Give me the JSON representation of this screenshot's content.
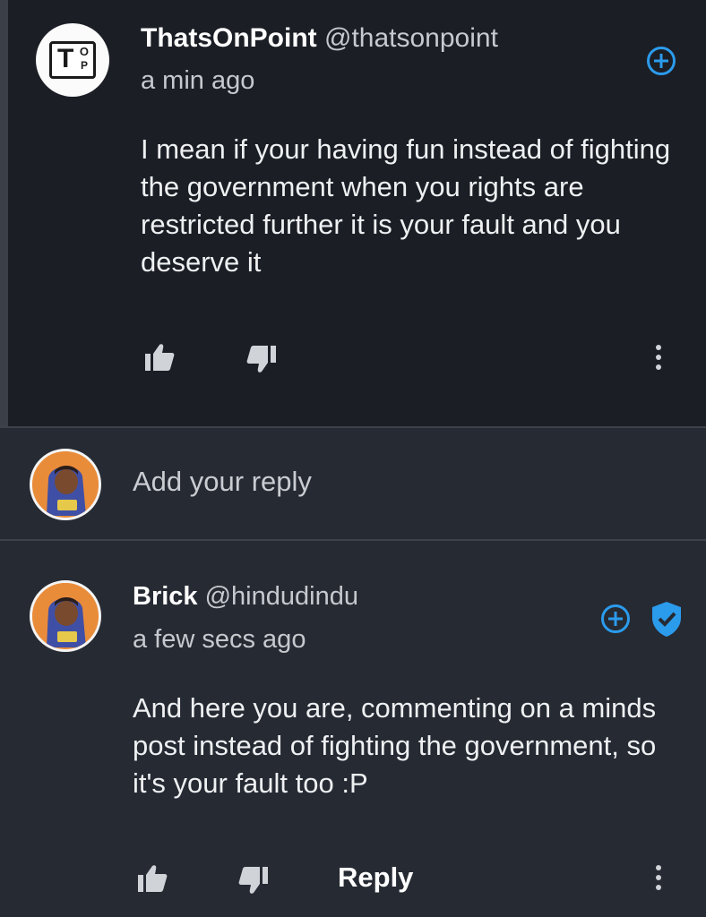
{
  "comments": [
    {
      "display_name": "ThatsOnPoint",
      "handle": "@thatsonpoint",
      "time": "a min ago",
      "text": "I mean if your having fun instead of fighting the government when you rights are restricted further it is your fault and you deserve it",
      "avatar_logo": {
        "t": "T",
        "o": "O",
        "p": "P"
      }
    },
    {
      "display_name": "Brick",
      "handle": "@hindudindu",
      "time": "a few secs ago",
      "text": "And here you are, commenting on a minds post instead of fighting the government, so it's your fault too :P",
      "verified": true,
      "reply_label": "Reply"
    }
  ],
  "reply_box": {
    "placeholder": "Add your reply"
  },
  "icons": {
    "thumbs_up": "thumbs-up-icon",
    "thumbs_down": "thumbs-down-icon",
    "more": "more-vertical-icon",
    "subscribe": "plus-circle-icon",
    "verified": "verified-shield-icon"
  },
  "colors": {
    "accent": "#2b9bec",
    "background": "#262a33",
    "thread_background": "#1b1e25",
    "avatar_orange": "#e98c3a"
  }
}
